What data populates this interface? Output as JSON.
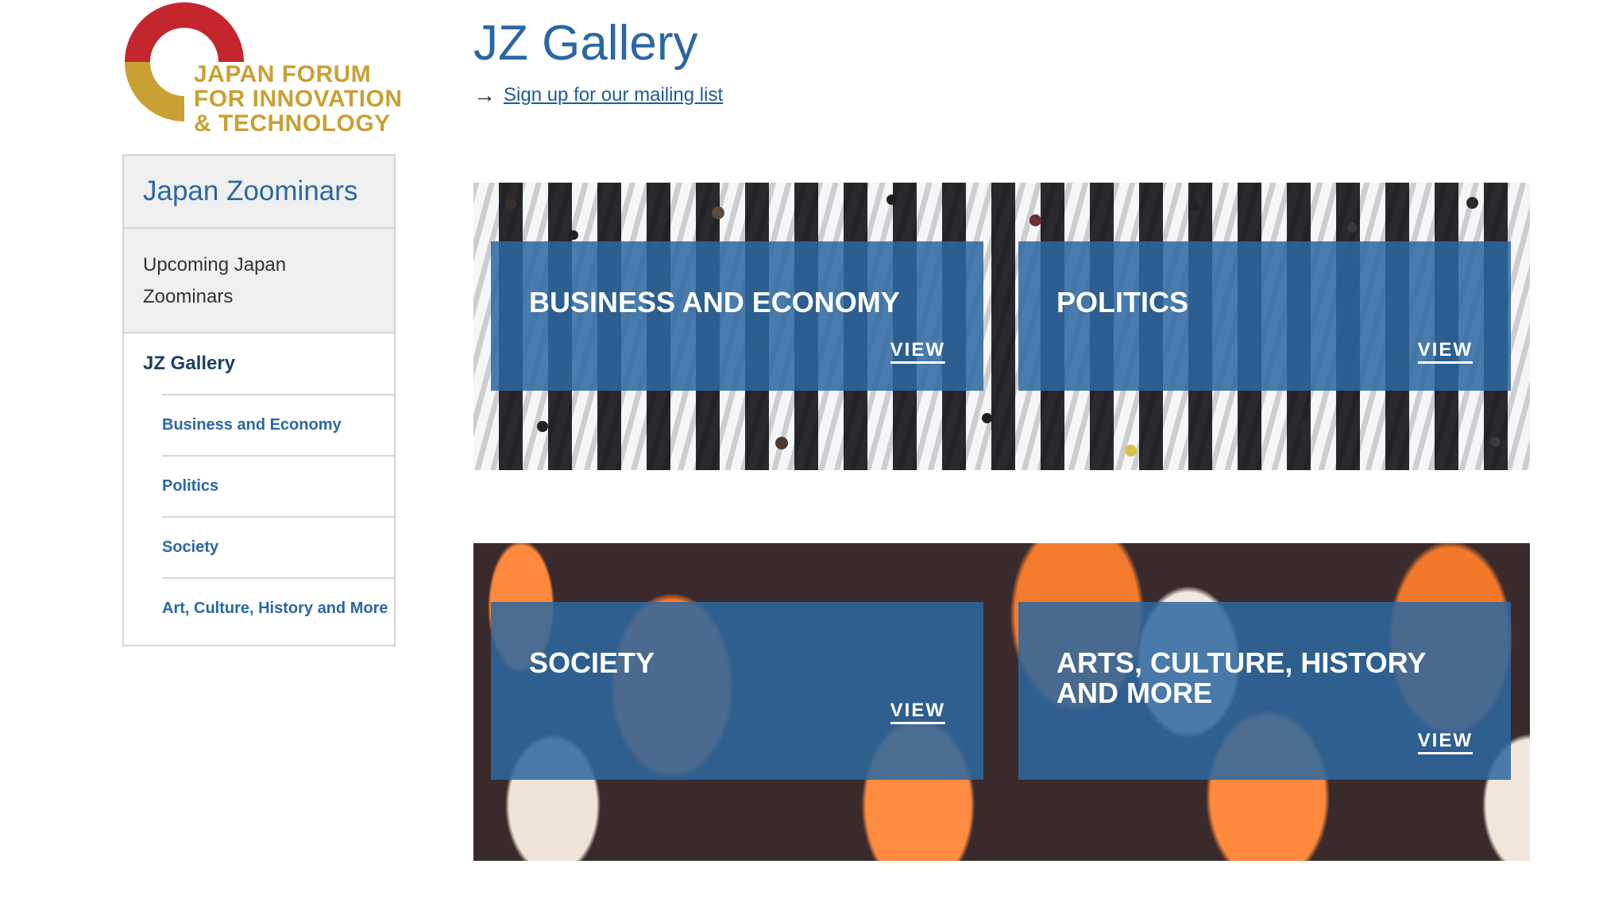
{
  "logo": {
    "lines": [
      "JAPAN FORUM",
      "FOR INNOVATION",
      "& TECHNOLOGY"
    ],
    "colors": {
      "red": "#c4262e",
      "gold": "#c9a033"
    }
  },
  "sidebar": {
    "title": "Japan Zoominars",
    "upcoming": [
      "Upcoming Japan",
      "Zoominars"
    ],
    "current": "JZ Gallery",
    "items": [
      {
        "label": "Business and Economy"
      },
      {
        "label": "Politics"
      },
      {
        "label": "Society"
      },
      {
        "label": "Art, Culture, History and More"
      }
    ]
  },
  "header": {
    "title": "JZ Gallery",
    "arrow": "→",
    "mailing_link": "Sign up for our mailing list"
  },
  "gallery": {
    "cards": [
      {
        "title": "BUSINESS AND ECONOMY",
        "view": "VIEW"
      },
      {
        "title": "POLITICS",
        "view": "VIEW"
      },
      {
        "title": "SOCIETY",
        "view": "VIEW"
      },
      {
        "title": "ARTS, CULTURE, HISTORY AND MORE",
        "view": "VIEW"
      }
    ]
  },
  "colors": {
    "accent": "#2a67a3",
    "card_overlay": "#2c68a0",
    "sidebar_bg": "#efefef"
  }
}
